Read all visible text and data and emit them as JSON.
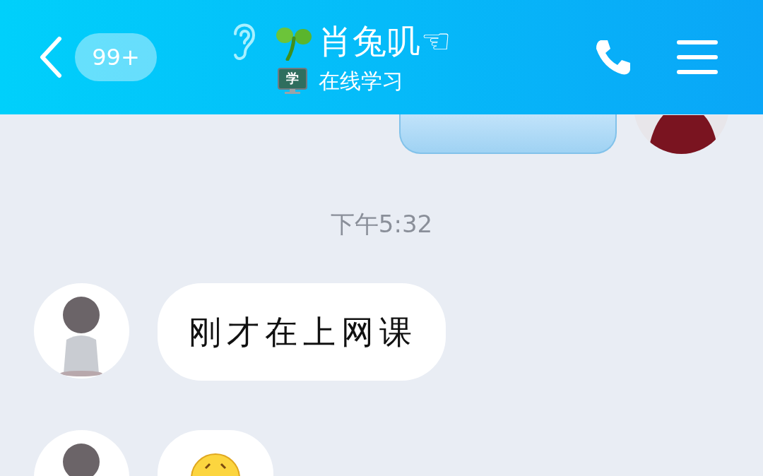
{
  "header": {
    "unread_badge": "99+",
    "title": "肖兔叽☜",
    "status_icon_text": "学",
    "status": "在线学习"
  },
  "messages": [
    {
      "kind": "sent"
    },
    {
      "kind": "time",
      "text": "下午5:32"
    },
    {
      "kind": "received",
      "text": "刚才在上网课"
    },
    {
      "kind": "emoji"
    }
  ]
}
